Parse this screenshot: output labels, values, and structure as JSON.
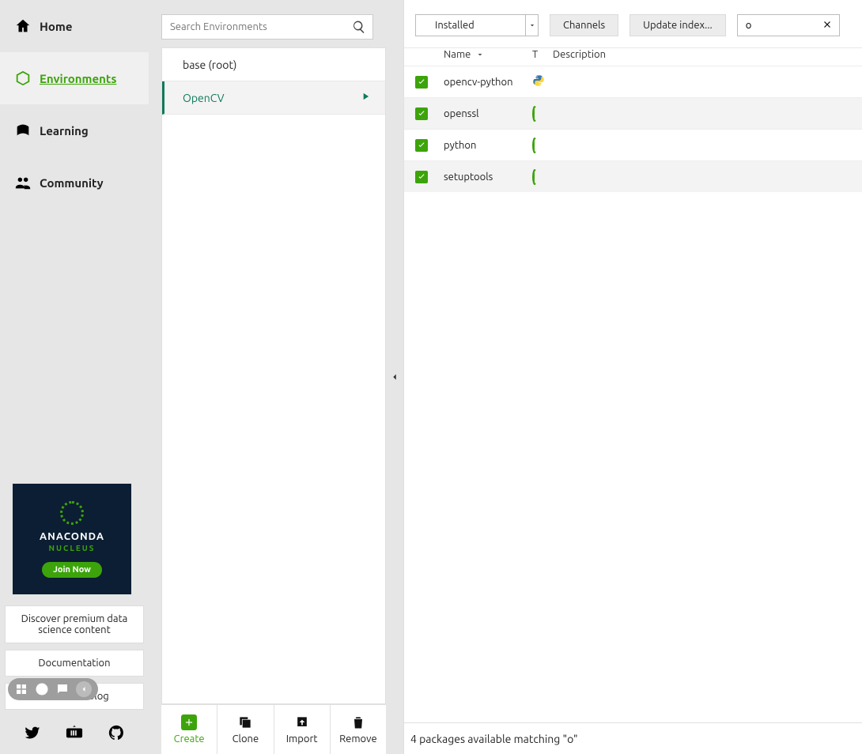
{
  "sidebar": {
    "items": [
      {
        "label": "Home",
        "icon": "home-icon",
        "active": false
      },
      {
        "label": "Environments",
        "icon": "cube-icon",
        "active": true
      },
      {
        "label": "Learning",
        "icon": "book-icon",
        "active": false
      },
      {
        "label": "Community",
        "icon": "people-icon",
        "active": false
      }
    ],
    "promo": {
      "brand": "ANACONDA",
      "sub": "NUCLEUS",
      "cta": "Join Now"
    },
    "links": [
      "Discover premium data science content",
      "Documentation",
      "Anaconda Blog"
    ]
  },
  "envs": {
    "search_placeholder": "Search Environments",
    "list": [
      {
        "name": "base (root)",
        "selected": false
      },
      {
        "name": "OpenCV",
        "selected": true
      }
    ],
    "actions": {
      "create": "Create",
      "clone": "Clone",
      "import": "Import",
      "remove": "Remove"
    }
  },
  "toolbar": {
    "filter": "Installed",
    "channels": "Channels",
    "update": "Update index...",
    "search_value": "o"
  },
  "pkg_header": {
    "name": "Name",
    "t": "T",
    "desc": "Description"
  },
  "packages": [
    {
      "name": "opencv-python",
      "type": "python"
    },
    {
      "name": "openssl",
      "type": "spinner"
    },
    {
      "name": "python",
      "type": "spinner"
    },
    {
      "name": "setuptools",
      "type": "spinner"
    }
  ],
  "status": "4 packages available matching \"o\""
}
